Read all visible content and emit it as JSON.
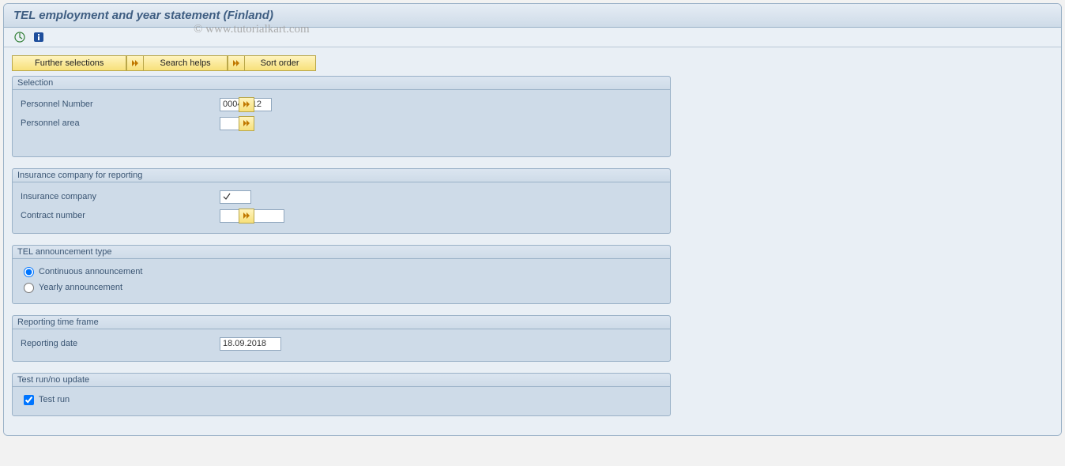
{
  "header": {
    "title": "TEL employment and year statement (Finland)"
  },
  "watermark": "© www.tutorialkart.com",
  "toolbar_buttons": {
    "further_selections": "Further selections",
    "search_helps": "Search helps",
    "sort_order": "Sort order"
  },
  "groups": {
    "selection": {
      "title": "Selection",
      "personnel_number_label": "Personnel Number",
      "personnel_number_value": "00041012",
      "personnel_area_label": "Personnel area",
      "personnel_area_value": ""
    },
    "insurance": {
      "title": "Insurance company for reporting",
      "insurance_company_label": "Insurance company",
      "insurance_company_value": "",
      "contract_number_label": "Contract number",
      "contract_number_value": ""
    },
    "tel_type": {
      "title": "TEL announcement type",
      "continuous_label": "Continuous announcement",
      "yearly_label": "Yearly announcement",
      "selected": "continuous"
    },
    "time_frame": {
      "title": "Reporting time frame",
      "reporting_date_label": "Reporting date",
      "reporting_date_value": "18.09.2018"
    },
    "test_run": {
      "title": "Test run/no update",
      "test_run_label": "Test run",
      "test_run_checked": true
    }
  }
}
